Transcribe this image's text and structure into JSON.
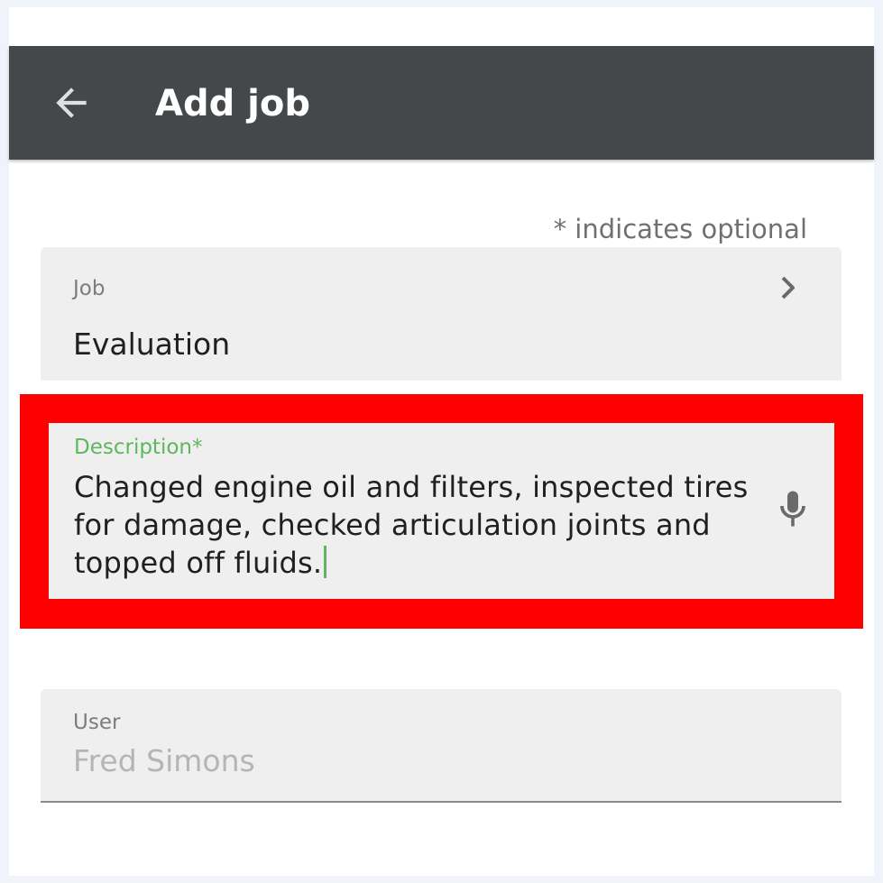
{
  "appbar": {
    "title": "Add job",
    "back_icon": "arrow-left-icon",
    "background": "#45484b"
  },
  "form": {
    "optional_note": "* indicates optional",
    "job": {
      "label": "Job",
      "value": "Evaluation",
      "icon": "chevron-right-icon"
    },
    "description": {
      "label": "Description*",
      "value": "Changed engine oil and filters, inspected tires for damage, checked articulation joints and topped off fluids.",
      "icon": "microphone-icon",
      "accent": "#5cb85c",
      "highlight_color": "#ff0000"
    },
    "user": {
      "label": "User",
      "value": "Fred Simons"
    }
  }
}
